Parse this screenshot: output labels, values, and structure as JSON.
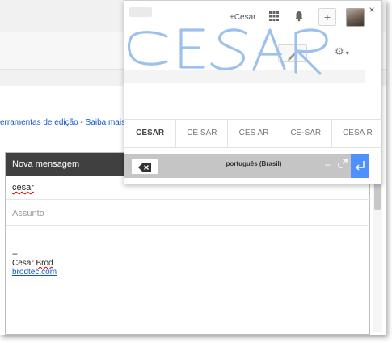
{
  "background": {
    "link_row": {
      "prefix": "erramentas de edição",
      "separator": " - ",
      "learn_more": "Saiba mais"
    }
  },
  "compose": {
    "title": "Nova mensagem",
    "to_value": "cesar",
    "subject_placeholder": "Assunto",
    "signature": {
      "dashes": "--",
      "first_name": "Cesar",
      "last_name": "Brod",
      "link": "brodtec.com"
    }
  },
  "handwriting": {
    "plus_name": "+Cesar",
    "plus_label": "+",
    "close_label": "×",
    "ink_text": "CESAR",
    "candidates": [
      "CESAR",
      "CE SAR",
      "CES AR",
      "CE-SAR",
      "CESA R"
    ],
    "language": "português (Brasil)",
    "minimize_label": "–",
    "gear_label": "⚙"
  },
  "colors": {
    "ink": "#9cc1ef",
    "accent": "#4d90fe",
    "link": "#1155cc",
    "compose_header": "#404040"
  },
  "icons": {
    "apps": "grid-icon",
    "notifications": "bell-icon",
    "backspace": "backspace-icon",
    "enter": "enter-icon",
    "settings": "gear-icon",
    "pencil": "pencil-icon"
  }
}
